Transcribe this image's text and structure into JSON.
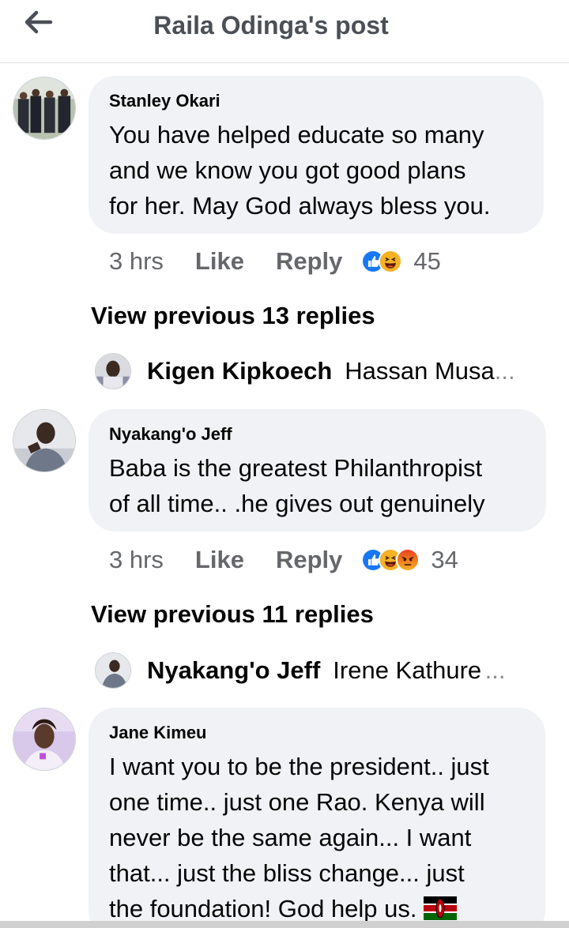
{
  "header": {
    "title": "Raila Odinga's post",
    "back_icon": "arrow-left-icon"
  },
  "colors": {
    "like_blue": "#1877f2",
    "haha_yellow": "#f7b125",
    "angry_orange": "#e9710f",
    "bubble_bg": "#f0f2f5",
    "meta_gray": "#65676b"
  },
  "comments": [
    {
      "author": "Stanley Okari",
      "text": "You have helped educate so many\nand we know you got good plans\nfor her. May God always bless you.",
      "time": "3 hrs",
      "like_label": "Like",
      "reply_label": "Reply",
      "reactions": [
        "like",
        "haha"
      ],
      "reaction_count": "45",
      "view_previous": "View previous 13 replies",
      "reply_preview": {
        "name": "Kigen Kipkoech",
        "text": "Hassan Musa",
        "ellipsis": "..."
      }
    },
    {
      "author": "Nyakang'o Jeff",
      "text": "Baba is the greatest Philanthropist\nof all time.. .he gives out genuinely",
      "time": "3 hrs",
      "like_label": "Like",
      "reply_label": "Reply",
      "reactions": [
        "like",
        "haha",
        "angry"
      ],
      "reaction_count": "34",
      "view_previous": "View previous 11 replies",
      "reply_preview": {
        "name": "Nyakang'o Jeff",
        "text": "Irene Kathure",
        "ellipsis": "..."
      }
    },
    {
      "author": "Jane Kimeu",
      "text": "I want you to be the president.. just\none time.. just one Rao. Kenya will\nnever be the same again... I want\nthat... just the bliss change... just\nthe foundation! God help us.",
      "emoji": "kenya-flag-icon"
    }
  ]
}
